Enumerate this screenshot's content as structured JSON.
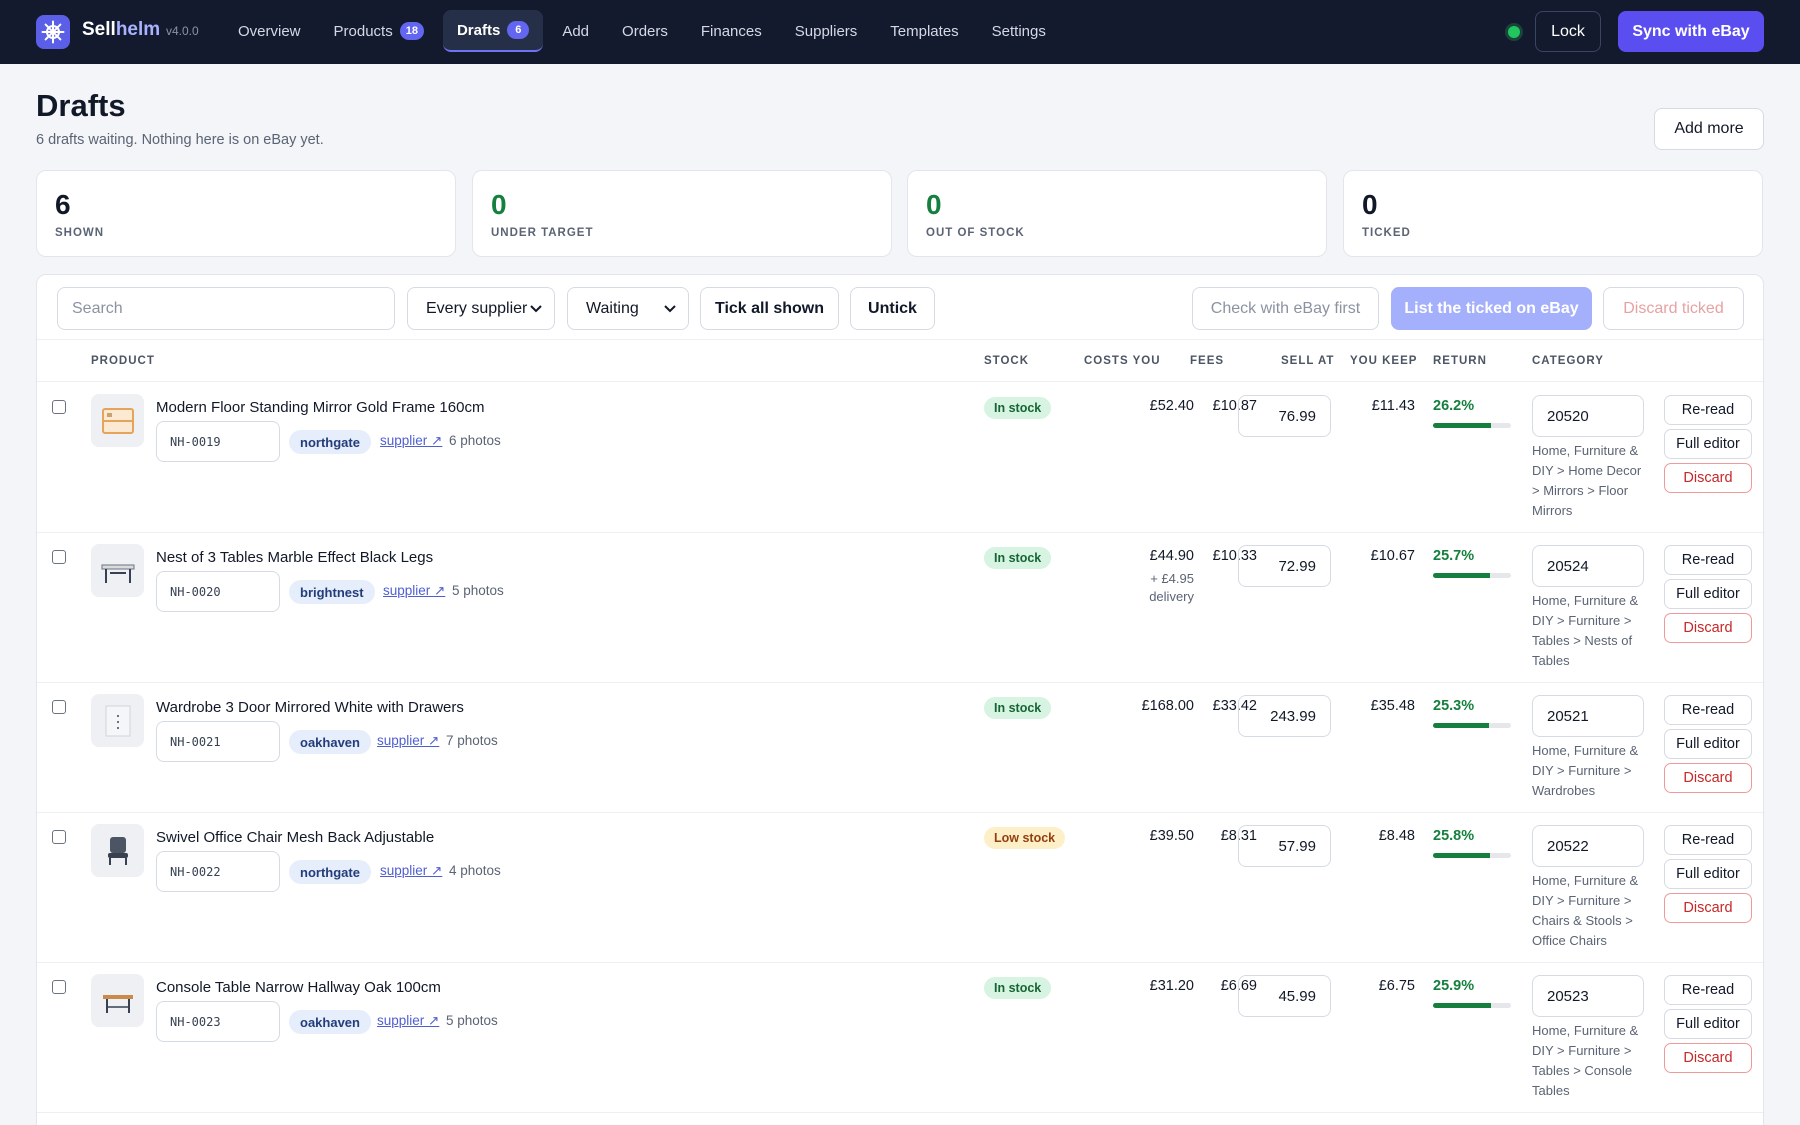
{
  "nav": {
    "brand_part1": "Sell",
    "brand_part2": "helm",
    "version": "v4.0.0",
    "links": [
      {
        "label": "Overview"
      },
      {
        "label": "Products",
        "badge": "18"
      },
      {
        "label": "Drafts",
        "badge": "6",
        "active": true
      },
      {
        "label": "Add"
      },
      {
        "label": "Orders"
      },
      {
        "label": "Finances"
      },
      {
        "label": "Suppliers"
      },
      {
        "label": "Templates"
      },
      {
        "label": "Settings"
      }
    ],
    "lock_label": "Lock",
    "sync_label": "Sync with eBay",
    "status_color": "#22c55e",
    "accent": "#5b4ef0",
    "logo_icon": "helm-icon"
  },
  "header": {
    "title": "Drafts",
    "subtitle": "6 drafts waiting. Nothing here is on eBay yet.",
    "add_more_label": "Add more"
  },
  "stats": [
    {
      "value": "6",
      "label": "SHOWN",
      "color": "#111827"
    },
    {
      "value": "0",
      "label": "UNDER TARGET",
      "color": "#15803d"
    },
    {
      "value": "0",
      "label": "OUT OF STOCK",
      "color": "#15803d"
    },
    {
      "value": "0",
      "label": "TICKED",
      "color": "#111827"
    }
  ],
  "toolbar": {
    "search_placeholder": "Search",
    "supplier_filter": "Every supplier",
    "status_filter": "Waiting",
    "tick_all_label": "Tick all shown",
    "untick_label": "Untick",
    "check_label": "Check with eBay first",
    "list_label": "List the ticked on eBay",
    "discard_label": "Discard ticked"
  },
  "columns": {
    "product": "PRODUCT",
    "stock": "STOCK",
    "costs": "COSTS YOU",
    "fees": "FEES",
    "sell": "SELL AT",
    "keep": "YOU KEEP",
    "return": "RETURN",
    "category": "CATEGORY"
  },
  "actions": {
    "reread": "Re-read",
    "editor": "Full editor",
    "discard": "Discard"
  },
  "products": [
    {
      "name": "Modern Floor Standing Mirror Gold Frame 160cm",
      "sku": "NH-0019",
      "supplier": "northgate",
      "supplier_link": "supplier ↗",
      "photos": "6 photos",
      "stock": "In stock",
      "stock_level": "in",
      "costs": "£52.40",
      "delivery": "",
      "fees": "£10.87",
      "sell": "76.99",
      "keep": "£11.43",
      "return": "26.2%",
      "return_pct": 26.2,
      "category_id": "20520",
      "category_path": "Home, Furniture & DIY > Home Decor > Mirrors > Floor Mirrors",
      "thumb_icon": "mirror-icon"
    },
    {
      "name": "Nest of 3 Tables Marble Effect Black Legs",
      "sku": "NH-0020",
      "supplier": "brightnest",
      "supplier_link": "supplier ↗",
      "photos": "5 photos",
      "stock": "In stock",
      "stock_level": "in",
      "costs": "£44.90",
      "delivery": "+ £4.95 delivery",
      "fees": "£10.33",
      "sell": "72.99",
      "keep": "£10.67",
      "return": "25.7%",
      "return_pct": 25.7,
      "category_id": "20524",
      "category_path": "Home, Furniture & DIY > Furniture > Tables > Nests of Tables",
      "thumb_icon": "table-icon"
    },
    {
      "name": "Wardrobe 3 Door Mirrored White with Drawers",
      "sku": "NH-0021",
      "supplier": "oakhaven",
      "supplier_link": "supplier ↗",
      "photos": "7 photos",
      "stock": "In stock",
      "stock_level": "in",
      "costs": "£168.00",
      "delivery": "",
      "fees": "£33.42",
      "sell": "243.99",
      "keep": "£35.48",
      "return": "25.3%",
      "return_pct": 25.3,
      "category_id": "20521",
      "category_path": "Home, Furniture & DIY > Furniture > Wardrobes",
      "thumb_icon": "wardrobe-icon"
    },
    {
      "name": "Swivel Office Chair Mesh Back Adjustable",
      "sku": "NH-0022",
      "supplier": "northgate",
      "supplier_link": "supplier ↗",
      "photos": "4 photos",
      "stock": "Low stock",
      "stock_level": "low",
      "costs": "£39.50",
      "delivery": "",
      "fees": "£8.31",
      "sell": "57.99",
      "keep": "£8.48",
      "return": "25.8%",
      "return_pct": 25.8,
      "category_id": "20522",
      "category_path": "Home, Furniture & DIY > Furniture > Chairs & Stools > Office Chairs",
      "thumb_icon": "chair-icon"
    },
    {
      "name": "Console Table Narrow Hallway Oak 100cm",
      "sku": "NH-0023",
      "supplier": "oakhaven",
      "supplier_link": "supplier ↗",
      "photos": "5 photos",
      "stock": "In stock",
      "stock_level": "in",
      "costs": "£31.20",
      "delivery": "",
      "fees": "£6.69",
      "sell": "45.99",
      "keep": "£6.75",
      "return": "25.9%",
      "return_pct": 25.9,
      "category_id": "20523",
      "category_path": "Home, Furniture & DIY > Furniture > Tables > Console Tables",
      "thumb_icon": "console-table-icon"
    }
  ]
}
